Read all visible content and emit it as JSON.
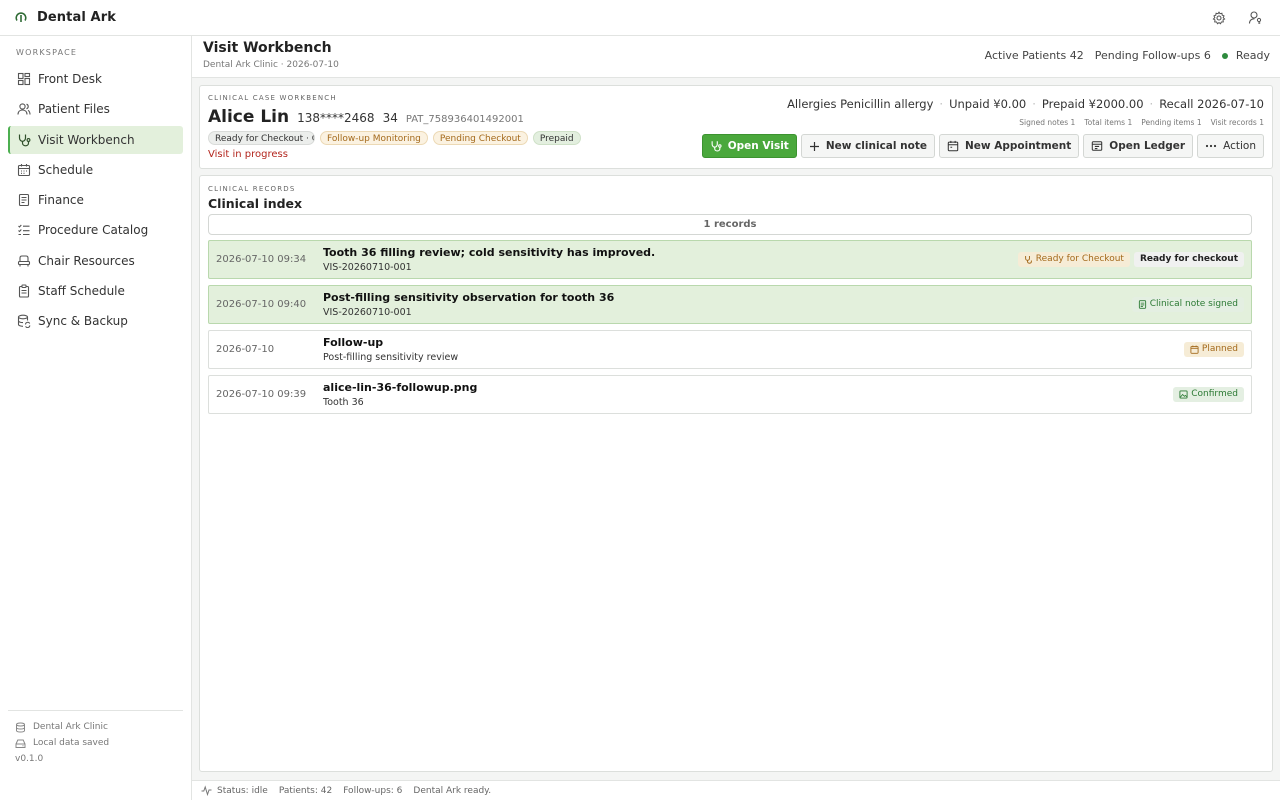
{
  "app": {
    "title": "Dental Ark"
  },
  "topbar": {
    "settings_icon": "gear-icon",
    "user_icon": "user-key-icon"
  },
  "sidebar": {
    "section_label": "WORKSPACE",
    "items": [
      {
        "label": "Front Desk",
        "icon": "dashboard-icon"
      },
      {
        "label": "Patient Files",
        "icon": "users-icon"
      },
      {
        "label": "Visit Workbench",
        "icon": "stethoscope-icon",
        "active": true
      },
      {
        "label": "Schedule",
        "icon": "calendar-icon"
      },
      {
        "label": "Finance",
        "icon": "receipt-icon"
      },
      {
        "label": "Procedure Catalog",
        "icon": "list-check-icon"
      },
      {
        "label": "Chair Resources",
        "icon": "chair-icon"
      },
      {
        "label": "Staff Schedule",
        "icon": "clipboard-icon"
      },
      {
        "label": "Sync & Backup",
        "icon": "database-sync-icon"
      }
    ],
    "footer": {
      "clinic": "Dental Ark Clinic",
      "saved": "Local data saved",
      "version": "v0.1.0"
    }
  },
  "header": {
    "title": "Visit Workbench",
    "subtitle": "Dental Ark Clinic · 2026-07-10",
    "active_patients": "Active Patients 42",
    "pending_followups": "Pending Follow-ups 6",
    "status": "Ready",
    "status_color": "#2e8b3e"
  },
  "case": {
    "section_label": "CLINICAL CASE WORKBENCH",
    "name": "Alice Lin",
    "phone": "138****2468",
    "age": "34",
    "patient_id": "PAT_758936401492001",
    "tags": [
      "Ready for Checkout · Ch",
      "Follow-up Monitoring",
      "Pending Checkout",
      "Prepaid"
    ],
    "status_text": "Visit in progress",
    "allergies": "Allergies Penicillin allergy",
    "unpaid": "Unpaid ¥0.00",
    "prepaid": "Prepaid ¥2000.00",
    "recall": "Recall 2026-07-10",
    "counts": [
      "Signed notes 1",
      "Total items 1",
      "Pending items 1",
      "Visit records 1"
    ],
    "actions": {
      "open_visit": "Open Visit",
      "new_note": "New clinical note",
      "new_appointment": "New Appointment",
      "open_ledger": "Open Ledger",
      "action": "Action"
    }
  },
  "records": {
    "section_label": "CLINICAL RECORDS",
    "title": "Clinical index",
    "count_label": "1 records",
    "rows": [
      {
        "time": "2026-07-10 09:34",
        "title": "Tooth 36 filling review; cold sensitivity has improved.",
        "subtitle": "VIS-20260710-001",
        "badges": [
          "Ready for Checkout",
          "Ready for checkout"
        ]
      },
      {
        "time": "2026-07-10 09:40",
        "title": "Post-filling sensitivity observation for tooth 36",
        "subtitle": "VIS-20260710-001",
        "badges": [
          "Clinical note signed"
        ]
      },
      {
        "time": "2026-07-10",
        "title": "Follow-up",
        "subtitle": "Post-filling sensitivity review",
        "badges": [
          "Planned"
        ]
      },
      {
        "time": "2026-07-10 09:39",
        "title": "alice-lin-36-followup.png",
        "subtitle": "Tooth 36",
        "badges": [
          "Confirmed"
        ]
      }
    ]
  },
  "statusbar": {
    "status": "Status: idle",
    "patients": "Patients: 42",
    "followups": "Follow-ups: 6",
    "message": "Dental Ark ready."
  },
  "colors": {
    "accent_green": "#4aa83c",
    "active_nav_bg": "#e3f0dc",
    "alert_red": "#b3261e",
    "amber": "#a46a1c"
  }
}
